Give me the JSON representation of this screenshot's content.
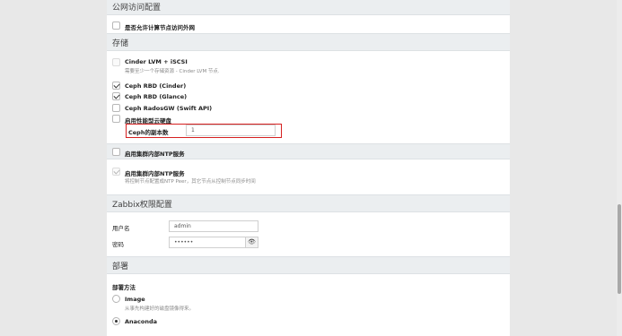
{
  "sections": {
    "public_access": {
      "title": "公网访问配置"
    },
    "storage": {
      "title": "存储"
    },
    "zabbix": {
      "title": "Zabbix权限配置"
    },
    "deploy": {
      "title": "部署"
    }
  },
  "public_access": {
    "allow_external_label": "是否允许计算节点访问外网"
  },
  "storage": {
    "cinder_lvm": {
      "label": "Cinder LVM + iSCSI",
      "hint": "需要至少一个存储资源 - Cinder LVM 节点."
    },
    "ceph_cinder": {
      "label": "Ceph RBD (Cinder)"
    },
    "ceph_glance": {
      "label": "Ceph RBD (Glance)"
    },
    "ceph_radosgw": {
      "label": "Ceph RadosGW (Swift API)"
    },
    "perf_cloud_disk": {
      "label": "启用性能型云硬盘"
    },
    "ceph_replicas": {
      "label": "Ceph的副本数",
      "value": "1"
    }
  },
  "ntp": {
    "enable_cluster_ntp": {
      "label": "启用集群内部NTP服务"
    },
    "enable_internal_ntp": {
      "label": "启用集群内部NTP服务",
      "hint": "将控制节点配置成NTP Peer，其它节点从控制节点同步时间"
    }
  },
  "zabbix": {
    "username_label": "用户名",
    "username_value": "admin",
    "password_label": "密码",
    "password_value": "••••••"
  },
  "deploy": {
    "method_label": "部署方法",
    "image": {
      "label": "Image",
      "hint": "从事先构建好的磁盘镜像得来。"
    },
    "anaconda": {
      "label": "Anaconda"
    }
  },
  "icons": {
    "eye": "👁"
  }
}
